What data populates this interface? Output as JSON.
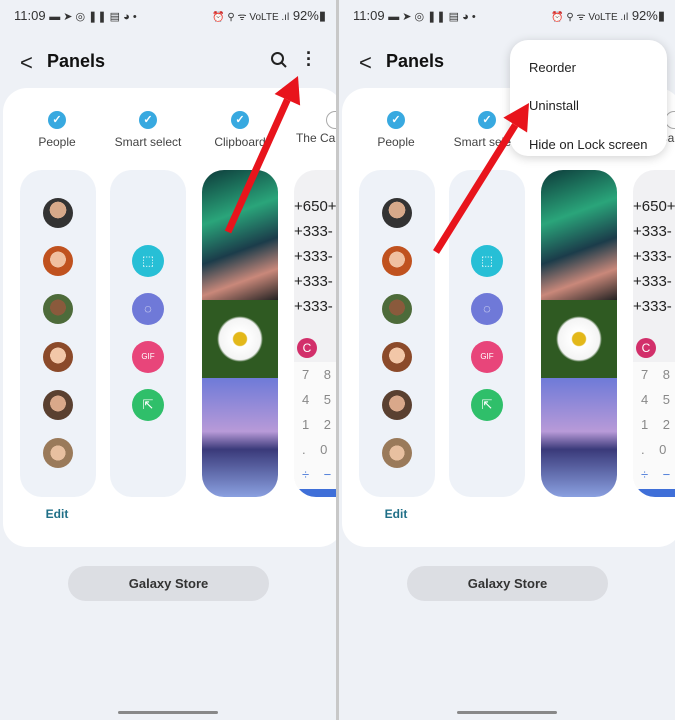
{
  "status": {
    "time": "11:09",
    "icons": "▬ ➤ ◎ ❚❚ ▤ ◕ •",
    "right_icons": "⏰ ⚲ ᯤ VoLTE .ıl",
    "battery": "92%"
  },
  "header": {
    "title": "Panels",
    "back": "<"
  },
  "tabs": [
    {
      "label": "People",
      "checked": true
    },
    {
      "label": "Smart select",
      "checked": true
    },
    {
      "label": "Clipboard",
      "checked": true
    },
    {
      "label": "The Calculator",
      "checked": false
    }
  ],
  "calc": {
    "lines": [
      "+650+",
      "+333-",
      "+333-",
      "+333-",
      "+333-"
    ],
    "clear": "C",
    "keys": [
      [
        "7",
        "8"
      ],
      [
        "4",
        "5"
      ],
      [
        "1",
        "2"
      ],
      [
        ".",
        "0"
      ],
      [
        "÷",
        "−"
      ]
    ]
  },
  "edit_label": "Edit",
  "store_label": "Galaxy Store",
  "menu": {
    "items": [
      "Reorder",
      "Uninstall",
      "Hide on Lock screen"
    ]
  },
  "colors": {
    "accent": "#38a9e0",
    "arrow": "#e8141c"
  }
}
